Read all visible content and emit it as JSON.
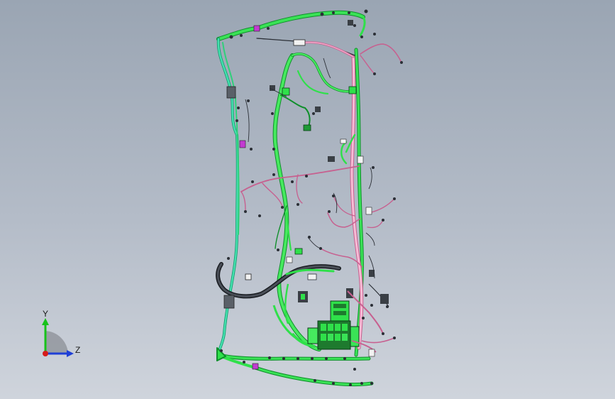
{
  "viewer": {
    "model": "vehicle-wiring-harness"
  },
  "triad": {
    "y_label": "Y",
    "z_label": "Z",
    "y_color": "#17c21a",
    "z_color": "#1f3fd6",
    "x_color": "#d61a1a",
    "view_disc_color": "#8b8f96"
  },
  "colors": {
    "background_top": "#9aa5b3",
    "background_bottom": "#cfd4dc",
    "harness_green": "#2fe04a",
    "harness_green_dark": "#0e8f2a",
    "harness_teal": "#36d6a6",
    "harness_pink": "#f0a6c8",
    "harness_pink_dark": "#c7608f",
    "harness_black": "#2b2f36",
    "connector_white": "#f2f2f2",
    "connector_magenta": "#c23bd1",
    "connector_dark": "#3a3f45"
  }
}
